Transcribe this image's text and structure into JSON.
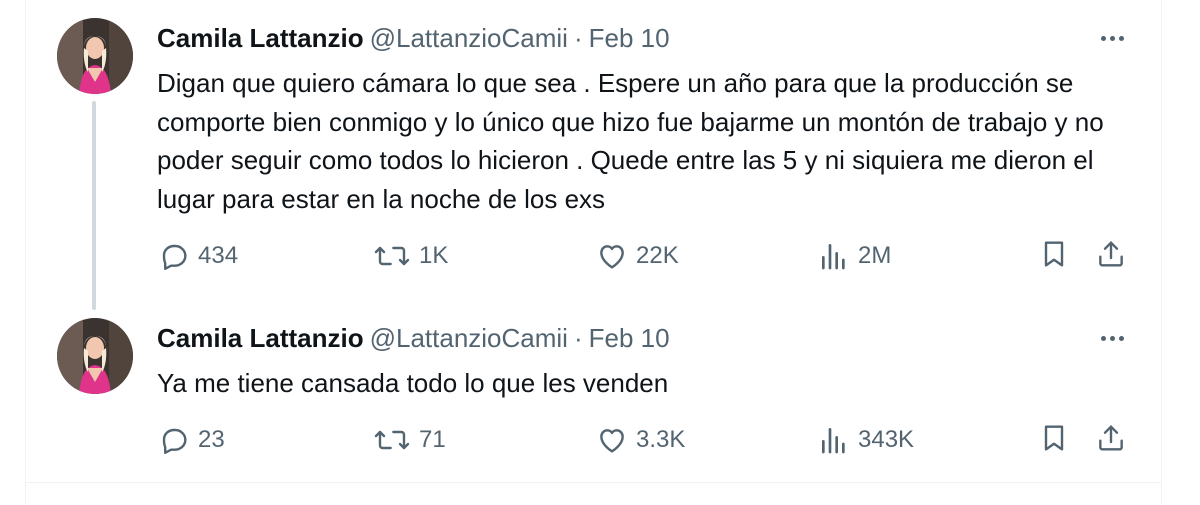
{
  "tweets": [
    {
      "author_name": "Camila Lattanzio",
      "handle": "@LattanzioCamii",
      "separator": "·",
      "date": "Feb 10",
      "text": "Digan que quiero cámara lo que sea . Espere un año para que la producción se comporte bien conmigo y lo único que hizo fue bajarme un montón de trabajo y no poder seguir como todos lo hicieron . Quede entre las 5 y ni siquiera me dieron el lugar para estar en la noche de los exs",
      "replies": "434",
      "reposts": "1K",
      "likes": "22K",
      "views": "2M"
    },
    {
      "author_name": "Camila Lattanzio",
      "handle": "@LattanzioCamii",
      "separator": "·",
      "date": "Feb 10",
      "text": "Ya me tiene cansada todo lo que les venden",
      "replies": "23",
      "reposts": "71",
      "likes": "3.3K",
      "views": "343K"
    }
  ],
  "icons": {
    "reply": "reply-icon",
    "repost": "repost-icon",
    "like": "heart-icon",
    "views": "views-icon",
    "bookmark": "bookmark-icon",
    "share": "share-icon",
    "more": "more-icon"
  },
  "colors": {
    "text_primary": "#0f1419",
    "text_secondary": "#536471",
    "thread_line": "#cfd9de",
    "divider": "#eff3f4",
    "avatar_outfit": "#e0338a"
  }
}
